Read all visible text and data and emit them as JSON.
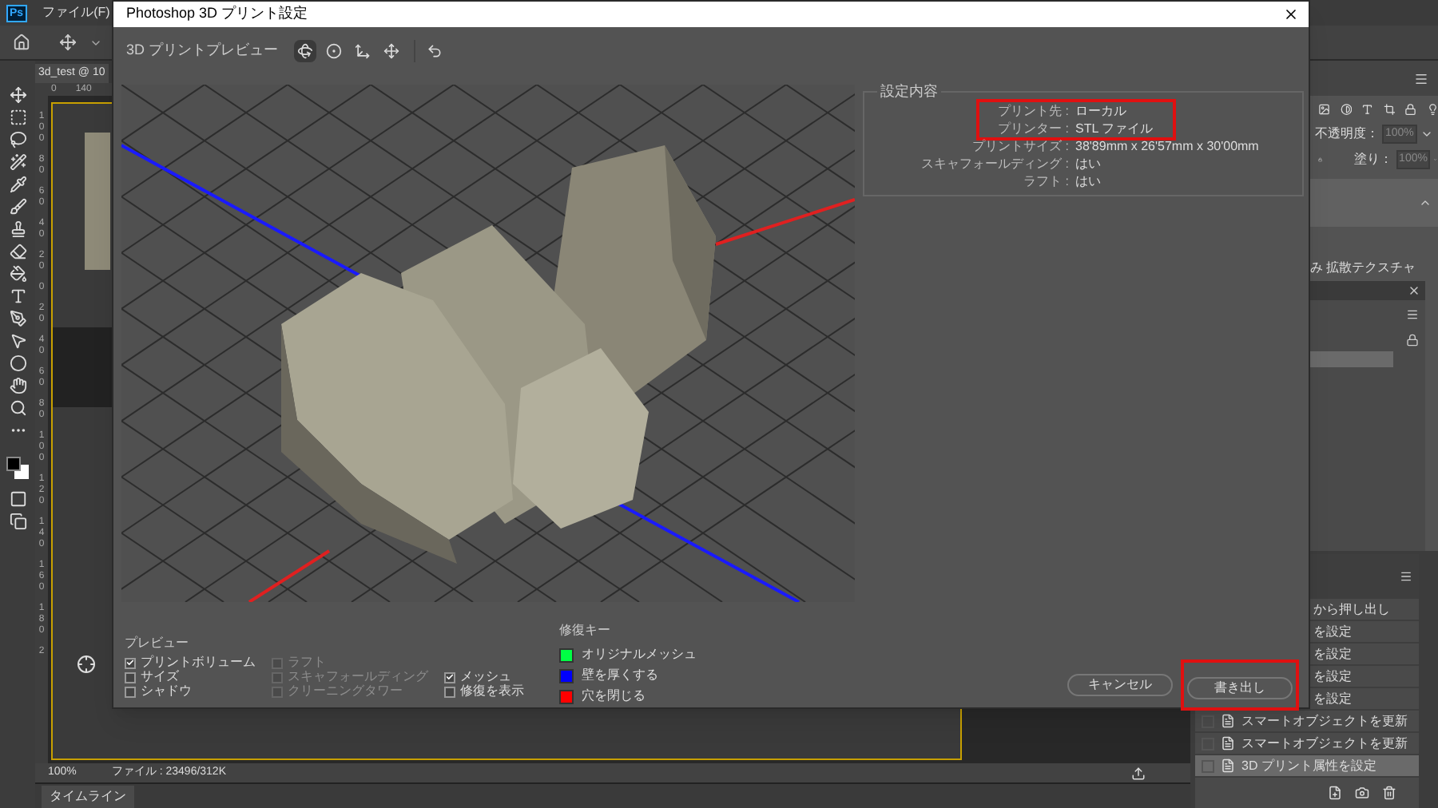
{
  "app": {
    "logo": "Ps",
    "menu": [
      {
        "label": "ファイル(F)"
      }
    ],
    "document_tab": "3d_test @ 10",
    "top_ruler": [
      "0",
      "140"
    ],
    "side_ruler": [
      "100",
      "80",
      "60",
      "40",
      "20",
      "0",
      "20",
      "40",
      "60",
      "80",
      "100",
      "120",
      "140",
      "160",
      "180",
      "2"
    ],
    "zoom": "100%",
    "file_info": "ファイル : 23496/312K",
    "timeline_tab": "タイムライン"
  },
  "layers": {
    "opacity_label": "不透明度：",
    "opacity": "100%",
    "fill_label": "塗り：",
    "fill": "100%",
    "layer_name": "み 拡散テクスチャ"
  },
  "history": {
    "items": [
      {
        "label": "から押し出し",
        "kind": "partial",
        "selected": false
      },
      {
        "label": "を設定",
        "kind": "partial",
        "selected": false
      },
      {
        "label": "を設定",
        "kind": "partial",
        "selected": false
      },
      {
        "label": "を設定",
        "kind": "partial",
        "selected": false
      },
      {
        "label": "を設定",
        "kind": "partial",
        "selected": false
      },
      {
        "label": "スマートオブジェクトを更新",
        "kind": "full",
        "selected": false
      },
      {
        "label": "スマートオブジェクトを更新",
        "kind": "full",
        "selected": false
      },
      {
        "label": "3D プリント属性を設定",
        "kind": "full",
        "selected": true
      }
    ]
  },
  "dialog": {
    "title": "Photoshop 3D プリント設定",
    "toolbar_label": "3D プリントプレビュー",
    "tools": [
      {
        "kind": "rotate",
        "selected": true
      },
      {
        "kind": "roll",
        "selected": false
      },
      {
        "kind": "pan",
        "selected": false
      },
      {
        "kind": "slide",
        "selected": false
      }
    ],
    "settings": {
      "legend": "設定内容",
      "rows": [
        {
          "label": "プリント先 :",
          "value": "ローカル",
          "highlighted": true
        },
        {
          "label": "プリンター :",
          "value": "STL ファイル",
          "highlighted": true
        },
        {
          "label": "プリントサイズ :",
          "value": "38'89mm x 26'57mm x 30'00mm",
          "highlighted": false
        },
        {
          "label": "スキャフォールディング :",
          "value": "はい",
          "highlighted": false
        },
        {
          "label": "ラフト :",
          "value": "はい",
          "highlighted": false
        }
      ]
    },
    "preview": {
      "title": "プレビュー",
      "columns": [
        [
          {
            "label": "プリントボリューム",
            "checked": true,
            "disabled": false
          },
          {
            "label": "サイズ",
            "checked": false,
            "disabled": false
          },
          {
            "label": "シャドウ",
            "checked": false,
            "disabled": false
          }
        ],
        [
          {
            "label": "ラフト",
            "checked": false,
            "disabled": true
          },
          {
            "label": "スキャフォールディング",
            "checked": false,
            "disabled": true
          },
          {
            "label": "クリーニングタワー",
            "checked": false,
            "disabled": true
          }
        ],
        [
          {
            "label": "メッシュ",
            "checked": true,
            "disabled": false
          },
          {
            "label": "修復を表示",
            "checked": false,
            "disabled": false
          }
        ]
      ]
    },
    "repair_key": {
      "title": "修復キー",
      "items": [
        {
          "label": "オリジナルメッシュ",
          "color": "#00ff44"
        },
        {
          "label": "壁を厚くする",
          "color": "#0000ff"
        },
        {
          "label": "穴を閉じる",
          "color": "#ff0000"
        }
      ]
    },
    "buttons": [
      {
        "label": "キャンセル",
        "highlighted": false
      },
      {
        "label": "書き出し",
        "highlighted": true
      }
    ]
  }
}
